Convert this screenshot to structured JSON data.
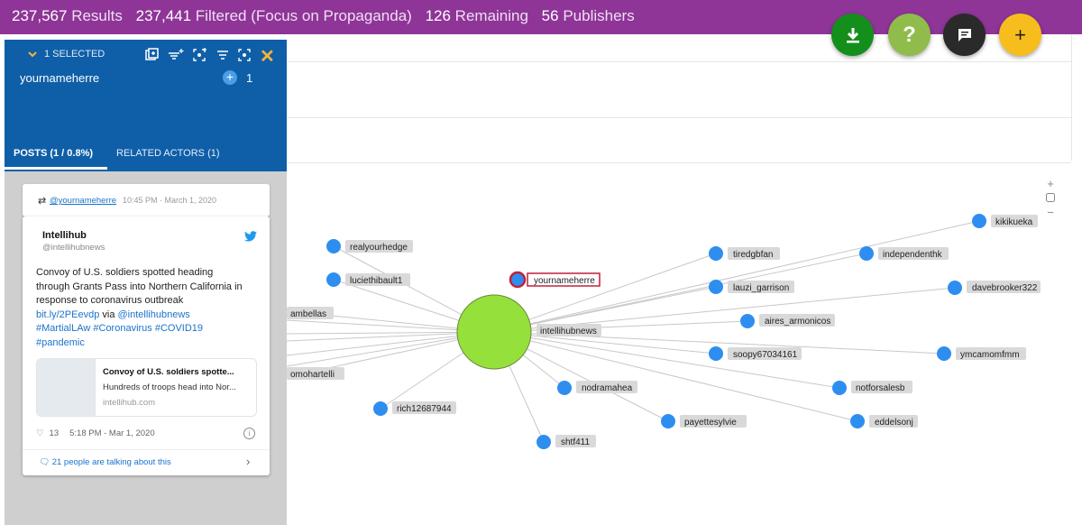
{
  "stats": {
    "results_count": "237,567",
    "results_label": "Results",
    "filtered_count": "237,441",
    "filtered_label": "Filtered (Focus on Propaganda)",
    "remaining_count": "126",
    "remaining_label": "Remaining",
    "publishers_count": "56",
    "publishers_label": "Publishers"
  },
  "fabs": {
    "download_color": "#148f1c",
    "help_color": "#8fbc4b",
    "help_label": "?",
    "comment_color": "#2a2a2a",
    "add_color": "#f7bd1c",
    "add_label": "+"
  },
  "panel": {
    "selected_label": "1 SELECTED",
    "actor_name": "yournameherre",
    "actor_count": "1",
    "tabs": {
      "posts": "POSTS (1 / 0.8%)",
      "related": "RELATED ACTORS (1)"
    }
  },
  "post": {
    "retweeter": "@yournameherre",
    "retweet_time": "10:45 PM · March 1, 2020",
    "author_name": "Intellihub",
    "author_handle": "@intellihubnews",
    "text_l1": "Convoy of U.S. soldiers spotted heading",
    "text_l2": "through Grants Pass into Northern California in",
    "text_l3": "response to coronavirus outbreak",
    "link_short": "bit.ly/2PEevdp",
    "via": "via",
    "via_handle": "@intellihubnews",
    "hashtags": "#MartialLAw #Coronavirus #COVID19",
    "hashtag2": "#pandemic",
    "card_title": "Convoy of U.S. soldiers spotte...",
    "card_desc": "Hundreds of troops head into Nor...",
    "card_site": "intellihub.com",
    "likes": "13",
    "timestamp": "5:18 PM - Mar 1, 2020",
    "talking": "21 people are talking about this"
  },
  "graph": {
    "hub": "intellihubnews",
    "selected": "yournameherre",
    "node_color": "#2e8ef0",
    "hub_color": "#96e03c",
    "nodes": [
      "realyourhedge",
      "luciethibault1",
      "rambellas",
      "oomohartelli",
      "rich12687944",
      "nodramahea",
      "shtf411",
      "payettesylvie",
      "tiredgbfan",
      "lauzi_garrison",
      "aires_armonicos",
      "soopy67034161",
      "notforsalesb",
      "eddelsonj",
      "independenthk",
      "kikikueka",
      "davebrooker322",
      "ymcamomfmm"
    ]
  },
  "zoom": {
    "in": "+",
    "out": "−"
  }
}
